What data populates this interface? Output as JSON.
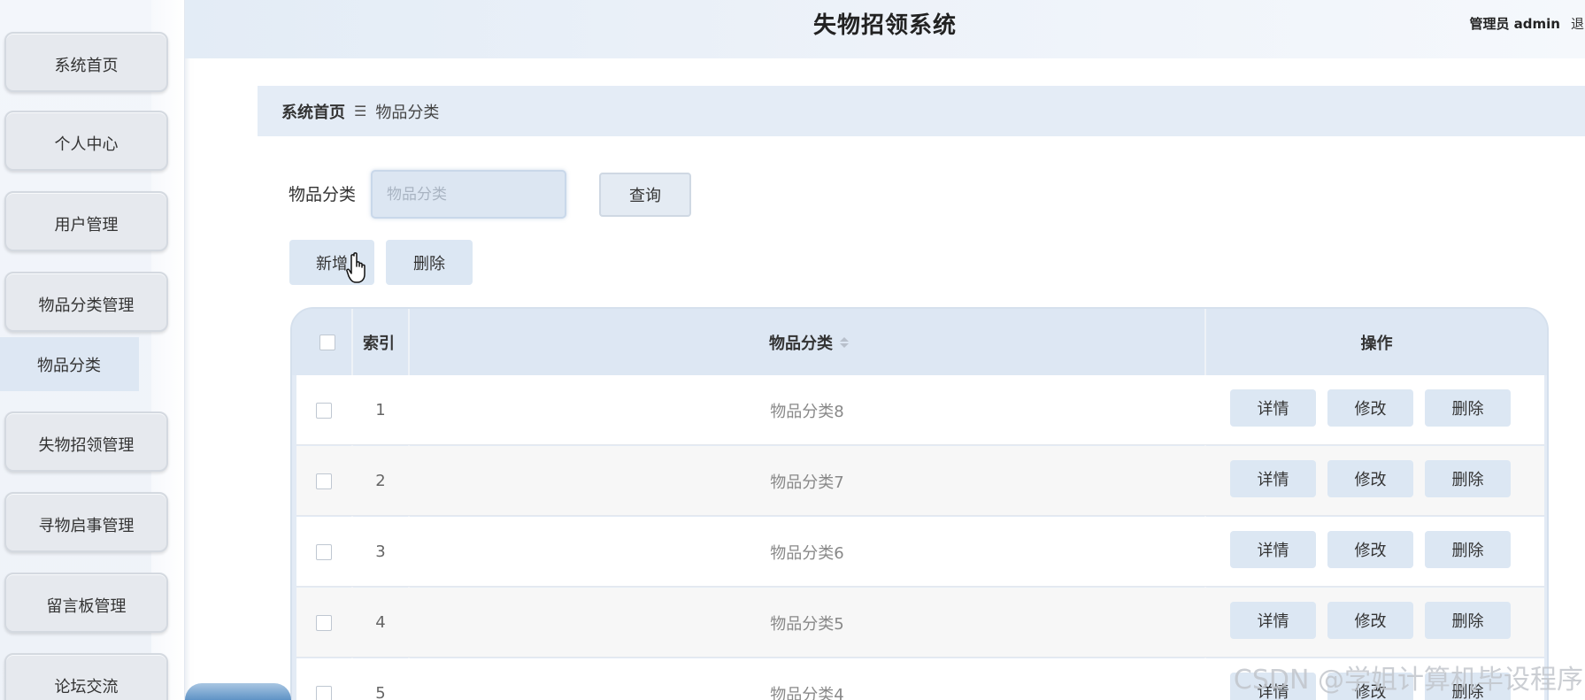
{
  "header": {
    "title": "失物招领系统",
    "admin_label": "管理员 admin",
    "logout": "退出"
  },
  "sidebar": {
    "items": [
      {
        "label": "系统首页"
      },
      {
        "label": "个人中心"
      },
      {
        "label": "用户管理"
      },
      {
        "label": "物品分类管理"
      },
      {
        "label": "失物招领管理"
      },
      {
        "label": "寻物启事管理"
      },
      {
        "label": "留言板管理"
      },
      {
        "label": "论坛交流"
      }
    ],
    "submenu_active": "物品分类"
  },
  "breadcrumb": {
    "home": "系统首页",
    "separator": "☰",
    "current": "物品分类"
  },
  "search": {
    "label": "物品分类",
    "placeholder": "物品分类",
    "value": "",
    "query_button": "查询"
  },
  "toolbar": {
    "add_label": "新增",
    "delete_label": "删除"
  },
  "table": {
    "columns": {
      "index": "索引",
      "name": "物品分类",
      "actions": "操作"
    },
    "row_actions": {
      "detail": "详情",
      "edit": "修改",
      "delete": "删除"
    },
    "rows": [
      {
        "index": "1",
        "name": "物品分类8"
      },
      {
        "index": "2",
        "name": "物品分类7"
      },
      {
        "index": "3",
        "name": "物品分类6"
      },
      {
        "index": "4",
        "name": "物品分类5"
      },
      {
        "index": "5",
        "name": "物品分类4"
      }
    ]
  },
  "watermark": "CSDN @学姐计算机毕设程序",
  "icons": {
    "cursor": "hand-pointer-icon",
    "sort": "sort-icon",
    "breadcrumb_separator": "menu-icon"
  },
  "colors": {
    "accent_light": "#dce7f3",
    "header_bg": "#e4ecf6",
    "button_gray": "#e6e9ee"
  }
}
